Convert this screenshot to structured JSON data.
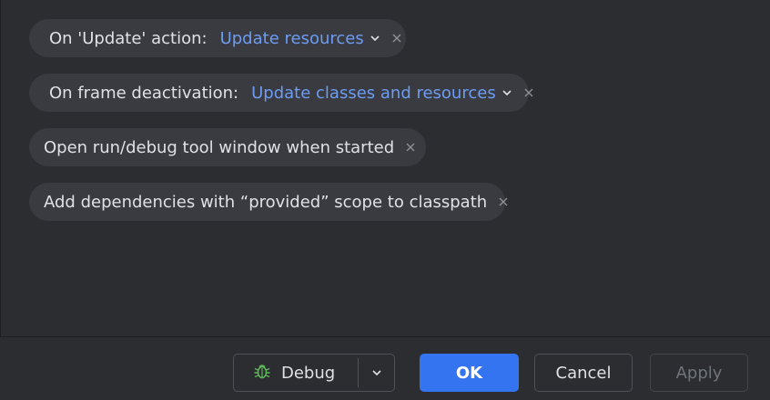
{
  "options": {
    "update_action": {
      "label": "On 'Update' action:",
      "value": "Update resources"
    },
    "frame_deactivation": {
      "label": "On frame deactivation:",
      "value": "Update classes and resources"
    },
    "open_tool_window": {
      "label": "Open run/debug tool window when started"
    },
    "provided_scope": {
      "label": "Add dependencies with “provided” scope to classpath"
    }
  },
  "footer": {
    "debug_label": "Debug",
    "ok_label": "OK",
    "cancel_label": "Cancel",
    "apply_label": "Apply"
  },
  "colors": {
    "background": "#2b2d30",
    "chip": "#393b40",
    "link_value": "#6d9cf2",
    "primary_button": "#3574f0",
    "debug_icon": "#5fb85b"
  },
  "icons": {
    "chevron": "chevron-down-icon",
    "remove": "close-icon",
    "debug": "bug-icon"
  },
  "state": {
    "apply_enabled": false
  }
}
